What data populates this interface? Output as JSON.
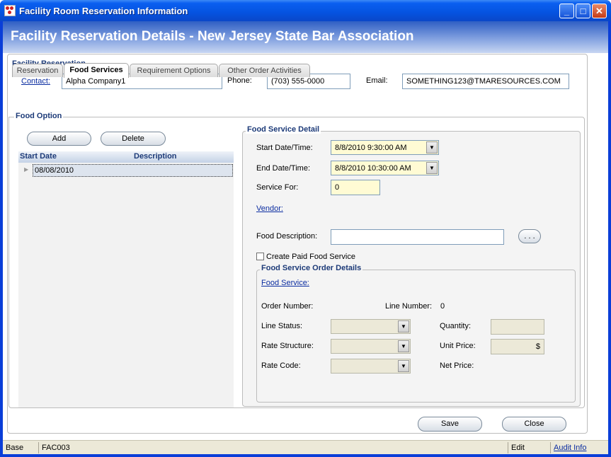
{
  "window": {
    "title": "Facility Room Reservation Information"
  },
  "header": {
    "title": "Facility Reservation Details - New Jersey State Bar Association"
  },
  "facility": {
    "group_label": "Facility Reservation",
    "contact_label": "Contact:",
    "contact_value": "Alpha Company1",
    "phone_label": "Phone:",
    "phone_value": "(703) 555-0000",
    "email_label": "Email:",
    "email_value": "SOMETHING123@TMARESOURCES.COM"
  },
  "tabs": [
    {
      "label": "Reservation"
    },
    {
      "label": "Food Services"
    },
    {
      "label": "Requirement Options"
    },
    {
      "label": "Other Order Activities"
    }
  ],
  "food_option": {
    "group_label": "Food Option",
    "add_label": "Add",
    "delete_label": "Delete",
    "columns": [
      "Start Date",
      "Description"
    ],
    "rows": [
      {
        "start_date": "08/08/2010",
        "description": ""
      }
    ]
  },
  "detail": {
    "group_label": "Food Service Detail",
    "start_label": "Start Date/Time:",
    "start_value": "8/8/2010 9:30:00 AM",
    "end_label": "End Date/Time:",
    "end_value": "8/8/2010 10:30:00 AM",
    "service_for_label": "Service For:",
    "service_for_value": "0",
    "vendor_label": "Vendor:",
    "food_desc_label": "Food Description:",
    "food_desc_value": "",
    "ellipsis_label": ". . .",
    "paid_label": "Create Paid Food Service"
  },
  "order": {
    "group_label": "Food Service Order Details",
    "food_service_label": "Food Service:",
    "order_number_label": "Order Number:",
    "line_number_label": "Line Number:",
    "line_number_value": "0",
    "line_status_label": "Line Status:",
    "quantity_label": "Quantity:",
    "rate_structure_label": "Rate Structure:",
    "unit_price_label": "Unit Price:",
    "unit_price_value": "$",
    "rate_code_label": "Rate Code:",
    "net_price_label": "Net Price:"
  },
  "footer": {
    "save_label": "Save",
    "close_label": "Close"
  },
  "status": {
    "mode": "Base",
    "code": "FAC003",
    "state": "Edit",
    "audit_label": "Audit Info"
  },
  "icons": {
    "dropdown": "chevron-down-icon",
    "row_pointer": "triangle-right-icon"
  }
}
